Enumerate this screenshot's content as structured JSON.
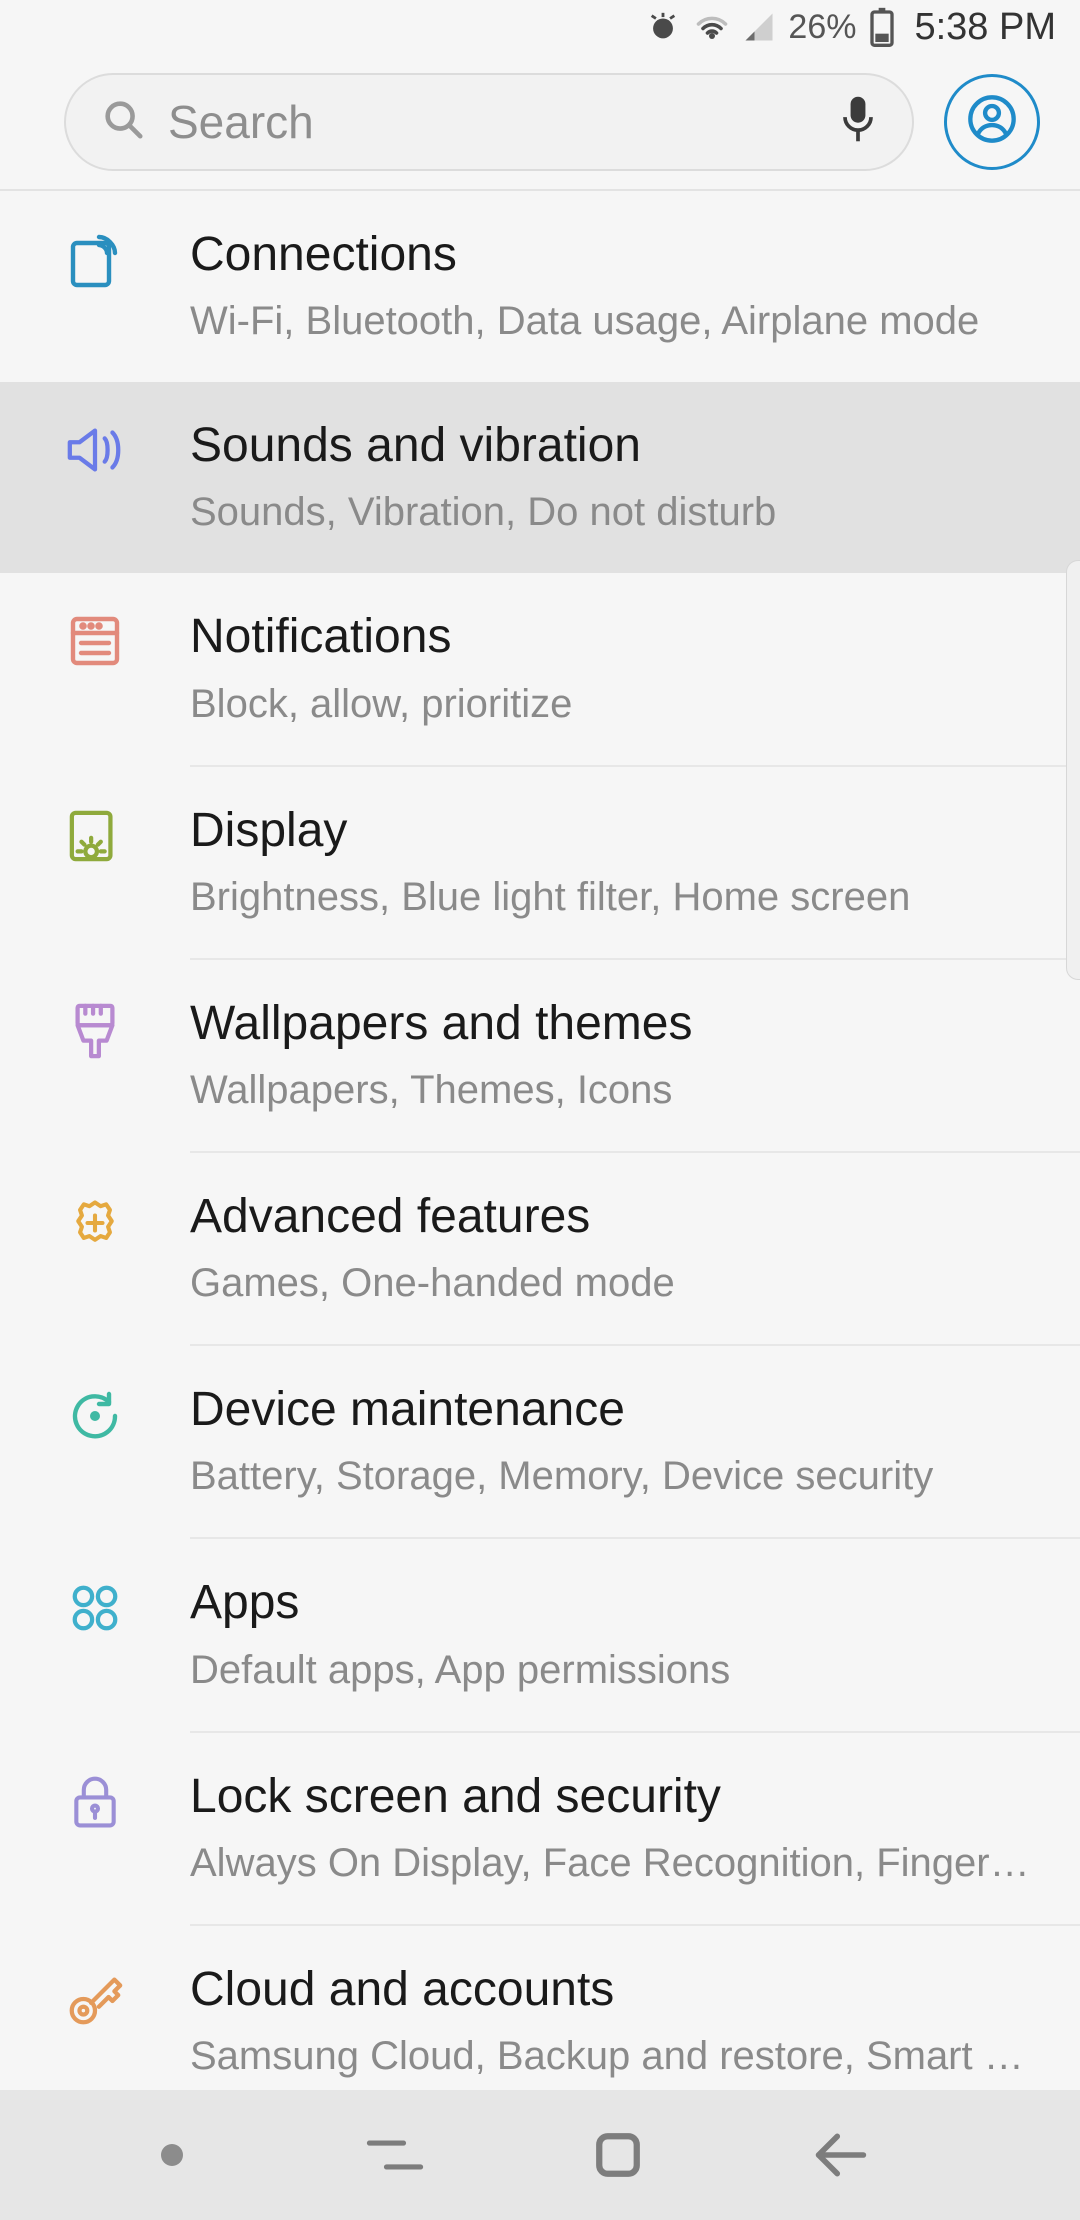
{
  "status": {
    "battery_pct": "26%",
    "time": "5:38 PM"
  },
  "search": {
    "placeholder": "Search"
  },
  "rows": [
    {
      "id": "connections",
      "title": "Connections",
      "sub": "Wi-Fi, Bluetooth, Data usage, Airplane mode",
      "selected": false,
      "icon": {
        "name": "sim-signal-icon",
        "tint": "#2a8fbf"
      }
    },
    {
      "id": "sounds",
      "title": "Sounds and vibration",
      "sub": "Sounds, Vibration, Do not disturb",
      "selected": true,
      "icon": {
        "name": "speaker-icon",
        "tint": "#6a7be8"
      }
    },
    {
      "id": "notifications",
      "title": "Notifications",
      "sub": "Block, allow, prioritize",
      "selected": false,
      "icon": {
        "name": "panel-icon",
        "tint": "#e28a7c"
      }
    },
    {
      "id": "display",
      "title": "Display",
      "sub": "Brightness, Blue light filter, Home screen",
      "selected": false,
      "icon": {
        "name": "brightness-tablet-icon",
        "tint": "#8faa3c"
      }
    },
    {
      "id": "wallpapers",
      "title": "Wallpapers and themes",
      "sub": "Wallpapers, Themes, Icons",
      "selected": false,
      "icon": {
        "name": "brush-icon",
        "tint": "#b88ad1"
      }
    },
    {
      "id": "advanced",
      "title": "Advanced features",
      "sub": "Games, One-handed mode",
      "selected": false,
      "icon": {
        "name": "gear-plus-icon",
        "tint": "#e5a93f"
      }
    },
    {
      "id": "maintenance",
      "title": "Device maintenance",
      "sub": "Battery, Storage, Memory, Device security",
      "selected": false,
      "icon": {
        "name": "refresh-circle-icon",
        "tint": "#3fb9a3"
      }
    },
    {
      "id": "apps",
      "title": "Apps",
      "sub": "Default apps, App permissions",
      "selected": false,
      "icon": {
        "name": "four-dots-icon",
        "tint": "#3fb0cc"
      }
    },
    {
      "id": "lockscreen",
      "title": "Lock screen and security",
      "sub": "Always On Display, Face Recognition, Fingerpri…",
      "selected": false,
      "icon": {
        "name": "lock-icon",
        "tint": "#9b8fd6"
      }
    },
    {
      "id": "cloud",
      "title": "Cloud and accounts",
      "sub": "Samsung Cloud, Backup and restore, Smart Sw…",
      "selected": false,
      "icon": {
        "name": "key-icon",
        "tint": "#e49a5a"
      }
    }
  ],
  "colors": {
    "accent": "#1f8bc9",
    "page": "#f6f6f6",
    "selected": "#e1e1e1"
  }
}
